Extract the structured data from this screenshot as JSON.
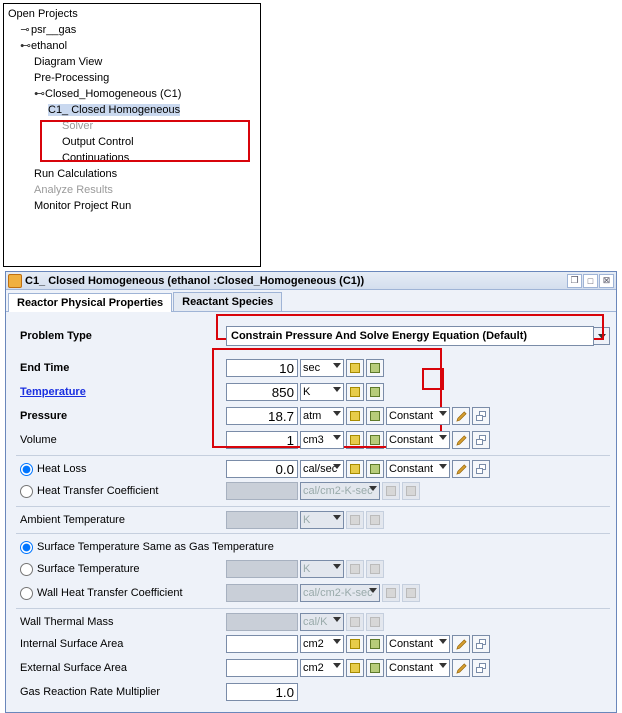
{
  "tree": {
    "root": "Open Projects",
    "proj1": "psr__gas",
    "proj2": "ethanol",
    "p2_diagram": "Diagram View",
    "p2_preproc": "Pre-Processing",
    "p2_closedhom": "Closed_Homogeneous (C1)",
    "p2_ch_c1": "C1_ Closed Homogeneous",
    "p2_ch_solver": "Solver",
    "p2_ch_output": "Output Control",
    "p2_ch_cont": "Continuations",
    "p2_runcalc": "Run Calculations",
    "p2_analyze": "Analyze Results",
    "p2_monitor": "Monitor Project Run"
  },
  "dialog": {
    "title": "C1_ Closed Homogeneous  (ethanol :Closed_Homogeneous (C1))",
    "tabs": {
      "phys": "Reactor Physical Properties",
      "species": "Reactant Species"
    },
    "labels": {
      "problem_type": "Problem Type",
      "end_time": "End Time",
      "temperature": "Temperature",
      "pressure": "Pressure",
      "volume": "Volume",
      "heat_loss": "Heat Loss",
      "heat_transfer_coef": "Heat Transfer Coefficient",
      "ambient_temp": "Ambient Temperature",
      "surf_same": "Surface Temperature Same as Gas Temperature",
      "surf_temp": "Surface Temperature",
      "wall_htc": "Wall Heat Transfer Coefficient",
      "wall_thermal_mass": "Wall Thermal Mass",
      "isa": "Internal Surface Area",
      "esa": "External Surface Area",
      "grrm": "Gas Reaction Rate Multiplier"
    },
    "values": {
      "problem_type": "Constrain Pressure And Solve Energy Equation (Default)",
      "end_time": "10",
      "temperature": "850",
      "pressure": "18.7",
      "volume": "1",
      "heat_loss": "0.0",
      "heat_transfer_coef": "",
      "ambient_temp": "",
      "surf_temp": "",
      "wall_htc": "",
      "wall_thermal_mass": "",
      "isa": "",
      "esa": "",
      "grrm": "1.0",
      "constant": "Constant"
    },
    "units": {
      "end_time": "sec",
      "temperature": "K",
      "pressure": "atm",
      "volume": "cm3",
      "heat_loss": "cal/sec",
      "htc": "cal/cm2-K-sec",
      "K": "K",
      "whtc": "cal/cm2-K-sec",
      "wtm": "cal/K",
      "isa": "cm2",
      "esa": "cm2"
    }
  }
}
